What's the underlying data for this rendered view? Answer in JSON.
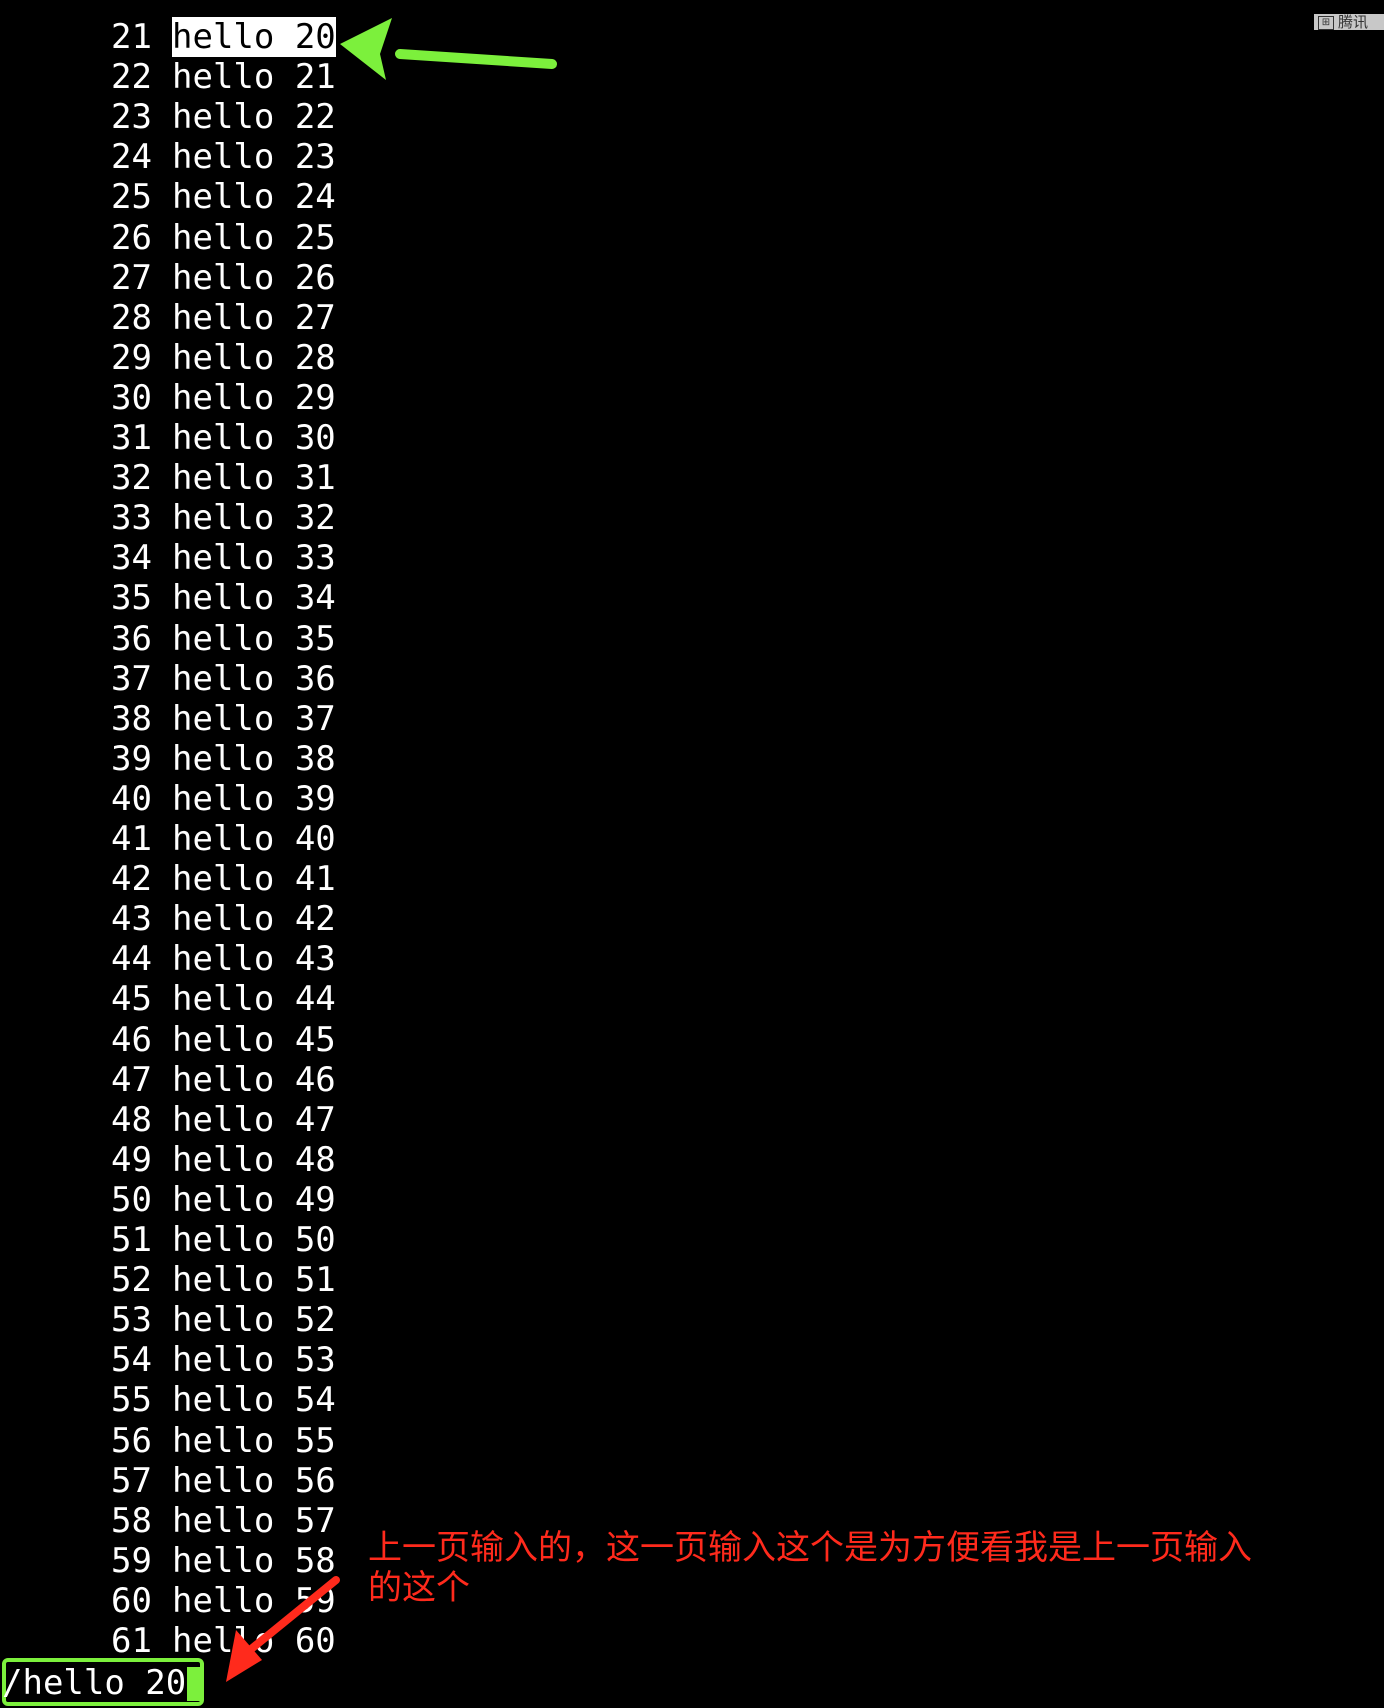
{
  "terminal": {
    "lines": [
      {
        "num": "21",
        "text": "hello 20",
        "highlight": true
      },
      {
        "num": "22",
        "text": "hello 21"
      },
      {
        "num": "23",
        "text": "hello 22"
      },
      {
        "num": "24",
        "text": "hello 23"
      },
      {
        "num": "25",
        "text": "hello 24"
      },
      {
        "num": "26",
        "text": "hello 25"
      },
      {
        "num": "27",
        "text": "hello 26"
      },
      {
        "num": "28",
        "text": "hello 27"
      },
      {
        "num": "29",
        "text": "hello 28"
      },
      {
        "num": "30",
        "text": "hello 29"
      },
      {
        "num": "31",
        "text": "hello 30"
      },
      {
        "num": "32",
        "text": "hello 31"
      },
      {
        "num": "33",
        "text": "hello 32"
      },
      {
        "num": "34",
        "text": "hello 33"
      },
      {
        "num": "35",
        "text": "hello 34"
      },
      {
        "num": "36",
        "text": "hello 35"
      },
      {
        "num": "37",
        "text": "hello 36"
      },
      {
        "num": "38",
        "text": "hello 37"
      },
      {
        "num": "39",
        "text": "hello 38"
      },
      {
        "num": "40",
        "text": "hello 39"
      },
      {
        "num": "41",
        "text": "hello 40"
      },
      {
        "num": "42",
        "text": "hello 41"
      },
      {
        "num": "43",
        "text": "hello 42"
      },
      {
        "num": "44",
        "text": "hello 43"
      },
      {
        "num": "45",
        "text": "hello 44"
      },
      {
        "num": "46",
        "text": "hello 45"
      },
      {
        "num": "47",
        "text": "hello 46"
      },
      {
        "num": "48",
        "text": "hello 47"
      },
      {
        "num": "49",
        "text": "hello 48"
      },
      {
        "num": "50",
        "text": "hello 49"
      },
      {
        "num": "51",
        "text": "hello 50"
      },
      {
        "num": "52",
        "text": "hello 51"
      },
      {
        "num": "53",
        "text": "hello 52"
      },
      {
        "num": "54",
        "text": "hello 53"
      },
      {
        "num": "55",
        "text": "hello 54"
      },
      {
        "num": "56",
        "text": "hello 55"
      },
      {
        "num": "57",
        "text": "hello 56"
      },
      {
        "num": "58",
        "text": "hello 57"
      },
      {
        "num": "59",
        "text": "hello 58"
      },
      {
        "num": "60",
        "text": "hello 59"
      },
      {
        "num": "61",
        "text": "hello 60"
      }
    ],
    "command_line": "/hello 20"
  },
  "top_right_label": "腾讯",
  "annotation": {
    "text": "上一页输入的，这一页输入这个是为方便看我是上一页输入的这个",
    "color": "#ff2a1c"
  },
  "colors": {
    "background": "#000000",
    "foreground": "#ffffff",
    "highlight_arrow": "#7cf03c",
    "annotation_arrow": "#ff2a1c"
  }
}
